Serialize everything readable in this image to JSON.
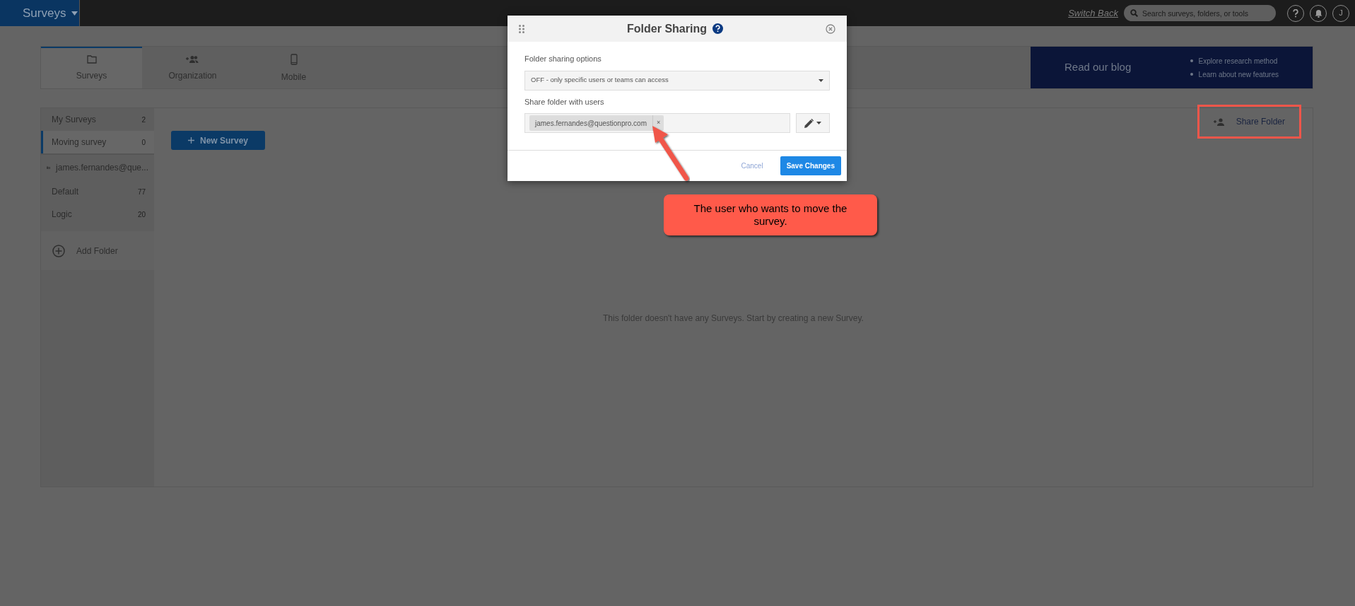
{
  "top_bar": {
    "product": "Surveys",
    "switch_back": "Switch Back",
    "search": {
      "placeholder": "Search surveys, folders, or tools"
    },
    "avatar": "J"
  },
  "tabs": [
    {
      "label": "Surveys",
      "selected": true
    },
    {
      "label": "Organization",
      "selected": false
    },
    {
      "label": "Mobile",
      "selected": false
    }
  ],
  "blog": {
    "title": "Read our blog",
    "points": [
      "Explore research method",
      "Learn about new features"
    ]
  },
  "sidebar": {
    "items": [
      {
        "kind": "folder",
        "label": "My Surveys",
        "count": "2",
        "selected": false
      },
      {
        "kind": "folder",
        "label": "Moving survey",
        "count": "0",
        "selected": true
      },
      {
        "kind": "owner",
        "label": "james.fernandes@que..."
      },
      {
        "kind": "folder",
        "label": "Default",
        "count": "77",
        "selected": false
      },
      {
        "kind": "folder",
        "label": "Logic",
        "count": "20",
        "selected": false
      }
    ],
    "add_folder": "Add Folder"
  },
  "main": {
    "new_survey": "New Survey",
    "share_folder": "Share Folder",
    "empty_message": "This folder doesn't have any Surveys. Start by creating a new Survey."
  },
  "dialog": {
    "title": "Folder Sharing",
    "options_label": "Folder sharing options",
    "option_value": "OFF - only specific users or teams can access",
    "users_label": "Share folder with users",
    "users": [
      {
        "email": "james.fernandes@questionpro.com",
        "remove": "×"
      }
    ],
    "cancel": "Cancel",
    "save": "Save Changes"
  },
  "annotation": {
    "text": "The user who wants to move the survey."
  }
}
